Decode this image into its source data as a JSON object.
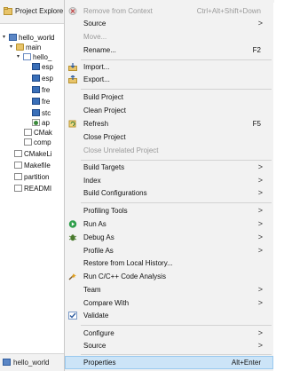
{
  "explorer": {
    "title": "Project Explore",
    "tree": [
      {
        "label": "hello_world",
        "icon": "project-icon"
      },
      {
        "label": "main",
        "icon": "source-folder-icon"
      },
      {
        "label": "hello_",
        "icon": "folder-icon"
      },
      {
        "label": "esp",
        "icon": "header-file-icon"
      },
      {
        "label": "esp",
        "icon": "header-file-icon"
      },
      {
        "label": "fre",
        "icon": "header-file-icon"
      },
      {
        "label": "fre",
        "icon": "header-file-icon"
      },
      {
        "label": "stc",
        "icon": "header-file-icon"
      },
      {
        "label": "ap",
        "icon": "source-file-icon"
      },
      {
        "label": "CMak",
        "icon": "file-icon"
      },
      {
        "label": "comp",
        "icon": "file-icon"
      },
      {
        "label": "CMakeLi",
        "icon": "file-icon"
      },
      {
        "label": "Makefile",
        "icon": "file-icon"
      },
      {
        "label": "partition",
        "icon": "file-icon"
      },
      {
        "label": "READMI",
        "icon": "file-icon"
      }
    ],
    "bottom_label": "hello_world"
  },
  "menu": {
    "items": [
      {
        "label": "Remove from Context",
        "accel": "Ctrl+Alt+Shift+Down",
        "disabled": true,
        "icon": "remove-context-icon"
      },
      {
        "label": "Source",
        "submenu": true
      },
      {
        "label": "Move...",
        "disabled": true
      },
      {
        "label": "Rename...",
        "accel": "F2"
      },
      {
        "label": "Import...",
        "icon": "import-icon"
      },
      {
        "label": "Export...",
        "icon": "export-icon"
      },
      {
        "label": "Build Project"
      },
      {
        "label": "Clean Project"
      },
      {
        "label": "Refresh",
        "accel": "F5",
        "icon": "refresh-icon"
      },
      {
        "label": "Close Project"
      },
      {
        "label": "Close Unrelated Project",
        "disabled": true
      },
      {
        "label": "Build Targets",
        "submenu": true
      },
      {
        "label": "Index",
        "submenu": true
      },
      {
        "label": "Build Configurations",
        "submenu": true
      },
      {
        "label": "Profiling Tools",
        "submenu": true
      },
      {
        "label": "Run As",
        "submenu": true,
        "icon": "run-icon"
      },
      {
        "label": "Debug As",
        "submenu": true,
        "icon": "debug-icon"
      },
      {
        "label": "Profile As",
        "submenu": true
      },
      {
        "label": "Restore from Local History..."
      },
      {
        "label": "Run C/C++ Code Analysis",
        "icon": "code-analysis-icon"
      },
      {
        "label": "Team",
        "submenu": true
      },
      {
        "label": "Compare With",
        "submenu": true
      },
      {
        "label": "Validate",
        "icon": "checkbox-checked-icon"
      },
      {
        "label": "Configure",
        "submenu": true
      },
      {
        "label": "Source",
        "submenu": true
      },
      {
        "label": "Properties",
        "accel": "Alt+Enter",
        "selected": true
      }
    ],
    "submenu_arrow": ">"
  },
  "colors": {
    "menu_bg": "#f2f2f2",
    "selected_bg": "#cce4f7",
    "disabled_text": "#9a9a9a",
    "run_icon": "#2e9e4a"
  }
}
